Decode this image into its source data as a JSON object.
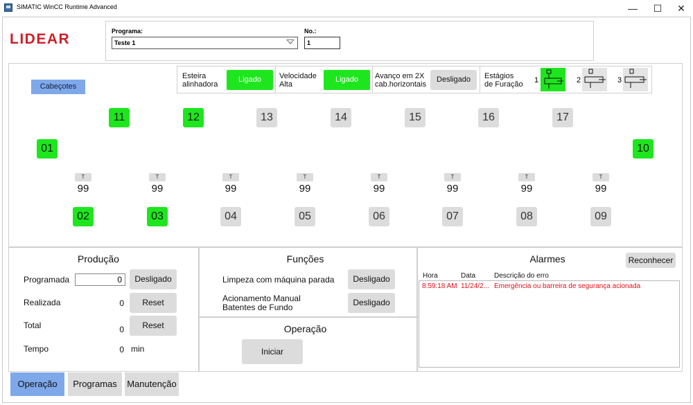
{
  "window": {
    "title": "SIMATIC WinCC Runtime Advanced",
    "minimize_glyph": "—",
    "maximize_glyph": "☐",
    "close_glyph": "✕"
  },
  "brand": {
    "logo_text": "LIDEAR",
    "logo_color": "#cc2028"
  },
  "program": {
    "label": "Programa:",
    "selected": "Teste 1",
    "no_label": "No.:",
    "no_value": "1"
  },
  "tabs": {
    "cabecotes": "Cabeçotes"
  },
  "controls": {
    "esteira_label_1": "Esteira",
    "esteira_label_2": "alinhadora",
    "esteira_state": "Ligado",
    "velocidade_label_1": "Velocidade",
    "velocidade_label_2": "Alta",
    "velocidade_state": "Ligado",
    "avanco_label_1": "Avanço em 2X",
    "avanco_label_2": "cab.horizontais",
    "avanco_state": "Desligado",
    "estagios_label_1": "Estágios",
    "estagios_label_2": "de Furação",
    "stages": [
      {
        "number": "1",
        "active": true
      },
      {
        "number": "2",
        "active": false
      },
      {
        "number": "3",
        "active": false
      }
    ]
  },
  "stations": {
    "top_row": [
      {
        "label": "11",
        "active": true
      },
      {
        "label": "12",
        "active": true
      },
      {
        "label": "13",
        "active": false
      },
      {
        "label": "14",
        "active": false
      },
      {
        "label": "15",
        "active": false
      },
      {
        "label": "16",
        "active": false
      },
      {
        "label": "17",
        "active": false
      }
    ],
    "left": {
      "label": "01",
      "active": true
    },
    "right": {
      "label": "10",
      "active": true
    },
    "bottom_row": [
      {
        "label": "02",
        "active": true,
        "t_label": "T",
        "t_value": "99"
      },
      {
        "label": "03",
        "active": true,
        "t_label": "T",
        "t_value": "99"
      },
      {
        "label": "04",
        "active": false,
        "t_label": "T",
        "t_value": "99"
      },
      {
        "label": "05",
        "active": false,
        "t_label": "T",
        "t_value": "99"
      },
      {
        "label": "06",
        "active": false,
        "t_label": "T",
        "t_value": "99"
      },
      {
        "label": "07",
        "active": false,
        "t_label": "T",
        "t_value": "99"
      },
      {
        "label": "08",
        "active": false,
        "t_label": "T",
        "t_value": "99"
      },
      {
        "label": "09",
        "active": false,
        "t_label": "T",
        "t_value": "99"
      }
    ]
  },
  "producao": {
    "title": "Produção",
    "programada_label": "Programada",
    "programada_value": "0",
    "programada_button": "Desligado",
    "realizada_label": "Realizada",
    "realizada_value": "0",
    "realizada_button": "Reset",
    "total_label": "Total",
    "total_value": "0",
    "total_button": "Reset",
    "tempo_label": "Tempo",
    "tempo_value": "0",
    "tempo_unit": "min"
  },
  "funcoes": {
    "title": "Funções",
    "limpeza_label": "Limpeza com máquina parada",
    "limpeza_button": "Desligado",
    "acionamento_label_1": "Acionamento Manual",
    "acionamento_label_2": "Batentes de Fundo",
    "acionamento_button": "Desligado"
  },
  "operacao_panel": {
    "title": "Operação",
    "iniciar_button": "Iniciar"
  },
  "alarmes": {
    "title": "Alarmes",
    "reconhecer_button": "Reconhecer",
    "columns": [
      "Hora",
      "Data",
      "Descrição do erro"
    ],
    "rows": [
      {
        "hora": "8:59:18 AM",
        "data": "11/24/2...",
        "descricao": "Emergência ou barreira de segurança acionada"
      }
    ]
  },
  "nav": {
    "operacao": "Operação",
    "programas": "Programas",
    "manutencao": "Manutenção"
  },
  "colors": {
    "active_green": "#1ee61e",
    "tab_blue": "#7fa8ea",
    "alarm_red": "#e0101a",
    "button_gray": "#dcdcdc"
  }
}
